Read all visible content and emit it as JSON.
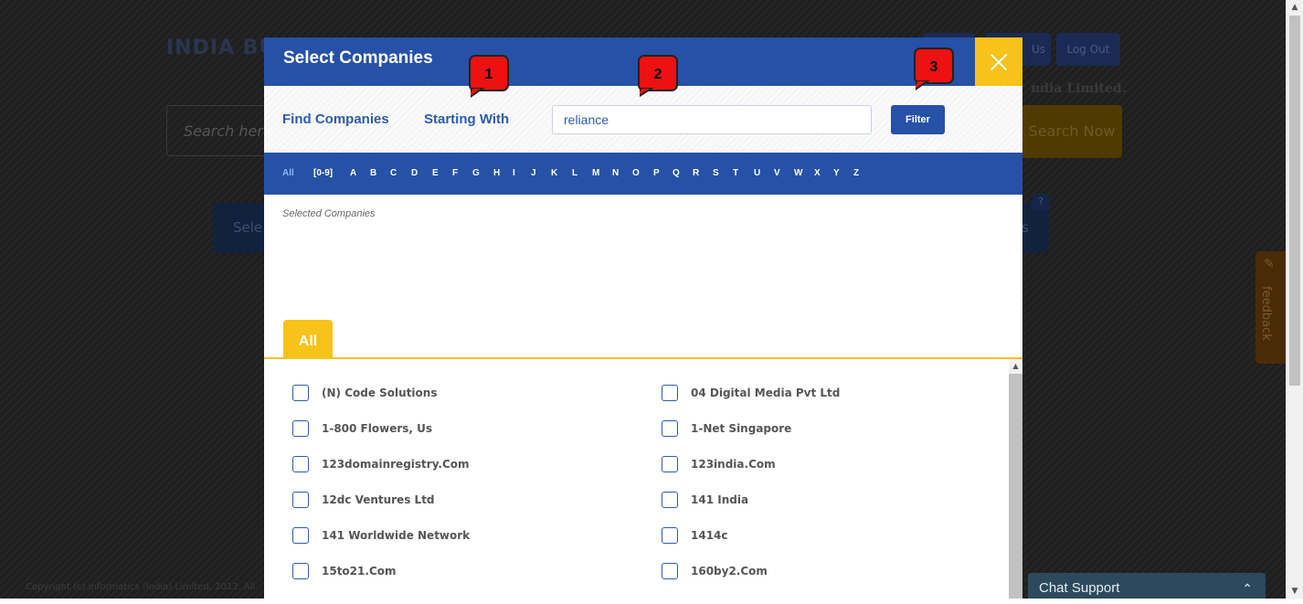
{
  "background": {
    "logo_text": "INDIA BU",
    "header_buttons": [
      "",
      "Us",
      "Log Out"
    ],
    "company_text": "ndia Limited.",
    "search_placeholder": "Search here",
    "search_button": "Search Now",
    "select_button": "Sele",
    "right_button": "s",
    "feedback_label": "feedback",
    "copyright": "Copyright (c) Informatics (India) Limited, 2013. All"
  },
  "modal": {
    "title": "Select Companies",
    "close_label": "×",
    "find_companies": "Find Companies",
    "starting_with": "Starting With",
    "search_value": "reliance",
    "filter_button": "Filter",
    "alphabet": [
      "All",
      "[0-9]",
      "A",
      "B",
      "C",
      "D",
      "E",
      "F",
      "G",
      "H",
      "I",
      "J",
      "K",
      "L",
      "M",
      "N",
      "O",
      "P",
      "Q",
      "R",
      "S",
      "T",
      "U",
      "V",
      "W",
      "X",
      "Y",
      "Z"
    ],
    "active_letter": "All",
    "selected_label": "Selected Companies",
    "tab_label": "All",
    "companies_left": [
      "(N) Code Solutions",
      "1-800 Flowers, Us",
      "123domainregistry.Com",
      "12dc Ventures Ltd",
      "141 Worldwide Network",
      "15to21.Com"
    ],
    "companies_right": [
      "04 Digital Media Pvt Ltd",
      "1-Net Singapore",
      "123india.Com",
      "141 India",
      "1414c",
      "160by2.Com"
    ]
  },
  "callouts": [
    "1",
    "2",
    "3"
  ],
  "chat": {
    "label": "Chat Support"
  },
  "colors": {
    "modal_blue": "#2651a6",
    "accent_yellow": "#f7c21a",
    "callout_red": "#ee1111",
    "chat_bg": "#2c4a5c"
  }
}
